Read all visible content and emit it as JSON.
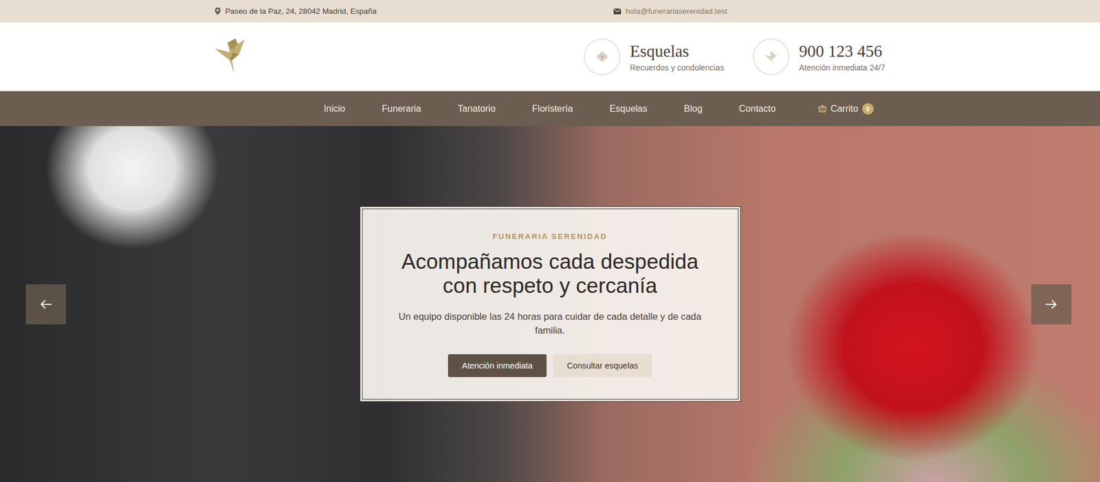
{
  "topbar": {
    "address": "Paseo de la Paz, 24, 28042 Madrid, España",
    "email": "hola@funerariaserenidad.test"
  },
  "header": {
    "info": [
      {
        "title": "Esquelas",
        "subtitle": "Recuerdos y condolencias",
        "kind": "flower"
      },
      {
        "title": "900 123 456",
        "subtitle": "Atención inmediata 24/7",
        "kind": "dove"
      }
    ]
  },
  "nav": {
    "items": [
      {
        "label": "Inicio"
      },
      {
        "label": "Funeraria"
      },
      {
        "label": "Tanatorio"
      },
      {
        "label": "Floristería"
      },
      {
        "label": "Esquelas"
      },
      {
        "label": "Blog"
      },
      {
        "label": "Contacto"
      }
    ],
    "cart": {
      "label": "Carrito",
      "count": "0"
    }
  },
  "hero": {
    "kicker": "FUNERARIA SERENIDAD",
    "title": "Acompañamos cada despedida con respeto y cercanía",
    "text": "Un equipo disponible las 24 horas para cuidar de cada detalle y de cada familia.",
    "buttons": [
      {
        "label": "Atención inmediata",
        "kind": "primary"
      },
      {
        "label": "Consultar esquelas",
        "kind": "secondary"
      }
    ]
  }
}
